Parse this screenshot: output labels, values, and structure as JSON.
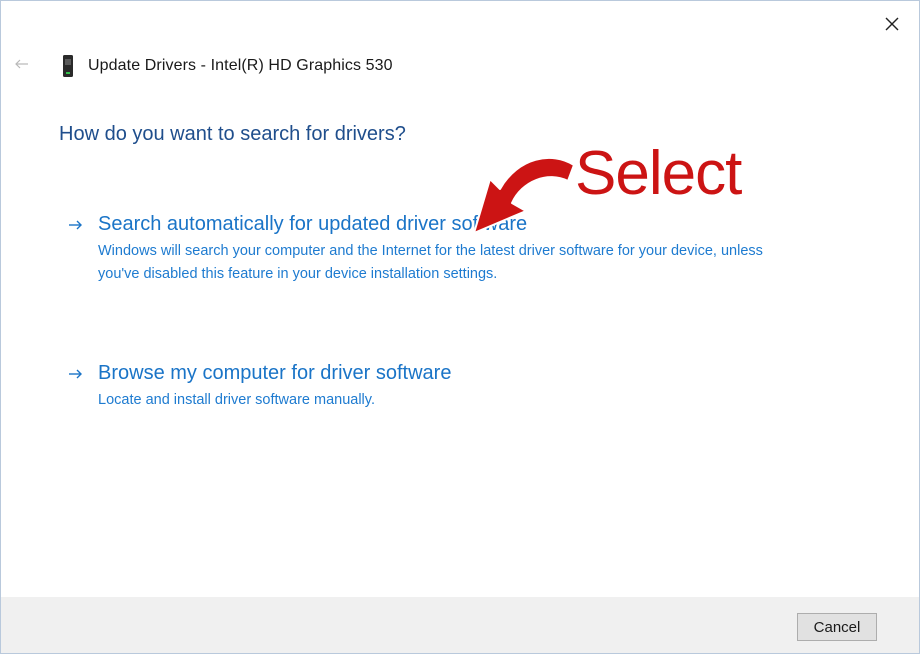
{
  "window": {
    "title": "Update Drivers - Intel(R) HD Graphics 530",
    "close_icon": "close-icon",
    "back_icon": "back-arrow-icon"
  },
  "main": {
    "question": "How do you want to search for drivers?",
    "options": [
      {
        "icon": "arrow-right-icon",
        "title": "Search automatically for updated driver software",
        "description": "Windows will search your computer and the Internet for the latest driver software for your device, unless you've disabled this feature in your device installation settings."
      },
      {
        "icon": "arrow-right-icon",
        "title": "Browse my computer for driver software",
        "description": "Locate and install driver software manually."
      }
    ]
  },
  "footer": {
    "cancel_label": "Cancel"
  },
  "annotation": {
    "label": "Select",
    "color": "#cc1414"
  },
  "colors": {
    "question": "#1f4e8c",
    "link": "#1a74c7",
    "footer_bg": "#f0f0f0"
  }
}
